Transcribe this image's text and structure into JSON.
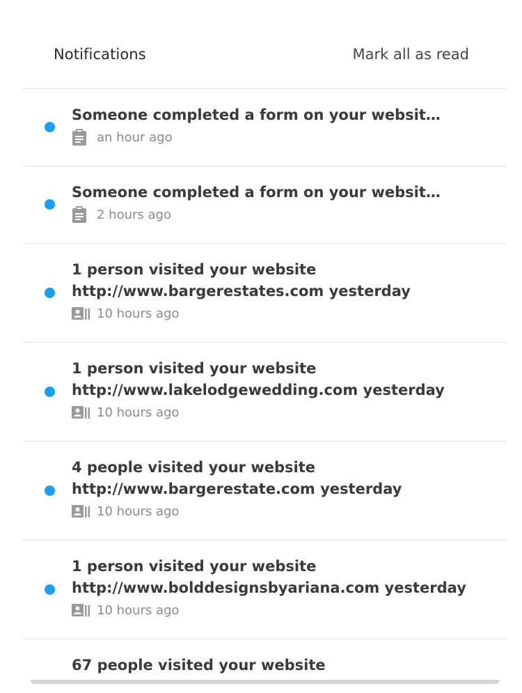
{
  "header": {
    "title": "Notifications",
    "mark_all_label": "Mark all as read"
  },
  "colors": {
    "unread_dot": "#1aa0f0",
    "text": "#3a3a3a",
    "muted": "#8a8a8a",
    "divider": "#e3e3e3"
  },
  "notifications": [
    {
      "line1": "Someone completed a form on your website htt...",
      "line2": "",
      "icon": "clipboard-icon",
      "time": "an hour ago",
      "unread": true
    },
    {
      "line1": "Someone completed a form on your website htt...",
      "line2": "",
      "icon": "clipboard-icon",
      "time": "2 hours ago",
      "unread": true
    },
    {
      "line1": "1 person visited your website",
      "line2": "http://www.bargerestates.com yesterday",
      "icon": "contact-card-icon",
      "time": "10 hours ago",
      "unread": true
    },
    {
      "line1": "1 person visited your website",
      "line2": "http://www.lakelodgewedding.com yesterday",
      "icon": "contact-card-icon",
      "time": "10 hours ago",
      "unread": true
    },
    {
      "line1": "4 people visited your website",
      "line2": "http://www.bargerestate.com yesterday",
      "icon": "contact-card-icon",
      "time": "10 hours ago",
      "unread": true
    },
    {
      "line1": "1 person visited your website",
      "line2": "http://www.bolddesignsbyariana.com yesterday",
      "icon": "contact-card-icon",
      "time": "10 hours ago",
      "unread": true
    },
    {
      "line1": "67 people visited your website",
      "line2": "",
      "icon": "",
      "time": "",
      "unread": false
    }
  ]
}
